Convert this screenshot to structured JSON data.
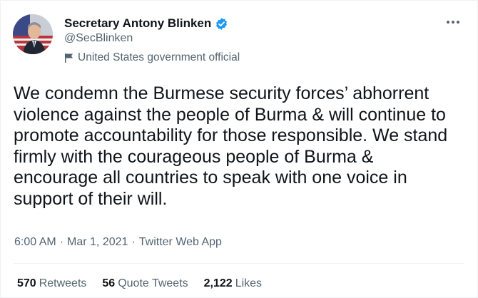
{
  "author": {
    "display_name": "Secretary Antony Blinken",
    "handle": "@SecBlinken",
    "label": "United States government official",
    "verified_color": "#1d9bf0"
  },
  "tweet": {
    "text": "We condemn the Burmese security forces’ abhorrent\nviolence against the people of Burma & will continue to\npromote accountability for those responsible. We stand\nfirmly with the courageous people of Burma &\nencourage all countries to speak with one voice in\nsupport of their will."
  },
  "meta": {
    "time": "6:00 AM",
    "separator": "·",
    "date": "Mar 1, 2021",
    "source": "Twitter Web App"
  },
  "stats": {
    "retweets_count": "570",
    "retweets_label": "Retweets",
    "quote_count": "56",
    "quote_label": "Quote Tweets",
    "likes_count": "2,122",
    "likes_label": "Likes"
  },
  "icons": {
    "avatar": "profile-photo",
    "verified": "verified-badge-icon",
    "flag": "flag-icon",
    "more": "more-options-icon"
  }
}
